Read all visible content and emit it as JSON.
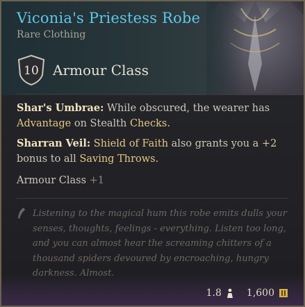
{
  "item": {
    "name": "Viconia's Priestess Robe",
    "rarity": "Rare Clothing",
    "armour_value": "10",
    "armour_label": "Armour Class"
  },
  "properties": {
    "umbrae_title": "Shar's Umbrae:",
    "umbrae_text1": " While obscured, the wearer has ",
    "umbrae_kw1": "Advantage",
    "umbrae_text2": " on Stealth ",
    "umbrae_kw2": "Checks",
    "umbrae_text3": ".",
    "veil_title": "Sharran Veil:",
    "veil_kw1": "Shield of Faith",
    "veil_text1": " also grants you a ",
    "veil_bonus": "+2",
    "veil_text2": " bonus to all ",
    "veil_kw2": "Saving Throws",
    "veil_text3": ".",
    "ac_bonus_label": "Armour Class",
    "ac_bonus_value": "+1"
  },
  "lore": "Listening to the magical hum this robe emits dulls your senses, thoughts, feelings - everything. Listen too long, and you can almost hear the screaming chitters of a thousand spiders devoured by encroaching, hungry darkness. Almost.",
  "footer": {
    "weight": "1.8",
    "weight_icon": "weight-icon",
    "price": "1,600",
    "price_icon": "gold-coin-icon"
  },
  "colors": {
    "name": "#5fc7e9",
    "keyword": "#e4c785",
    "border": "#6b6250"
  }
}
